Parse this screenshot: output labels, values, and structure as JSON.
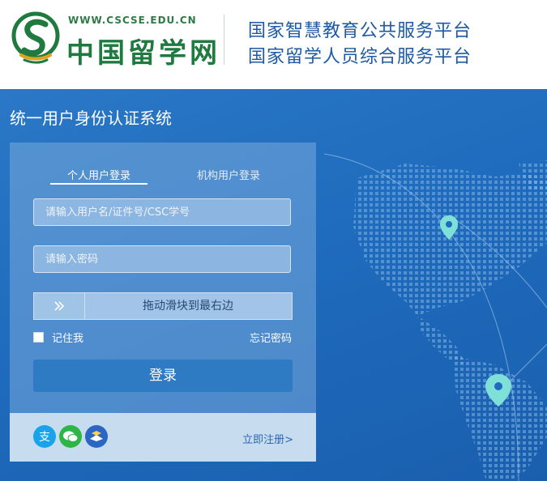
{
  "header": {
    "logo_url": "WWW.CSCSE.EDU.CN",
    "logo_name": "中国留学网",
    "platform_line1": "国家智慧教育公共服务平台",
    "platform_line2": "国家留学人员综合服务平台"
  },
  "main": {
    "system_title": "统一用户身份认证系统"
  },
  "login": {
    "tabs": [
      {
        "label": "个人用户登录",
        "active": true
      },
      {
        "label": "机构用户登录",
        "active": false
      }
    ],
    "username_placeholder": "请输入用户名/证件号/CSC学号",
    "password_placeholder": "请输入密码",
    "slider_text": "拖动滑块到最右边",
    "slider_icon": "double-chevron-right-icon",
    "remember_label": "记住我",
    "forgot_label": "忘记密码",
    "submit_label": "登录"
  },
  "footer": {
    "social_icons": [
      "alipay-icon",
      "wechat-icon",
      "csc-icon"
    ],
    "register_label": "立即注册>"
  },
  "colors": {
    "brand_green": "#1f7a3f",
    "platform_blue": "#1e5aa3",
    "background_blue": "#1f6bbd",
    "button_blue": "#2f7bc3",
    "alipay": "#1aa3e8",
    "wechat": "#2fb547",
    "csc": "#2a66c2"
  }
}
